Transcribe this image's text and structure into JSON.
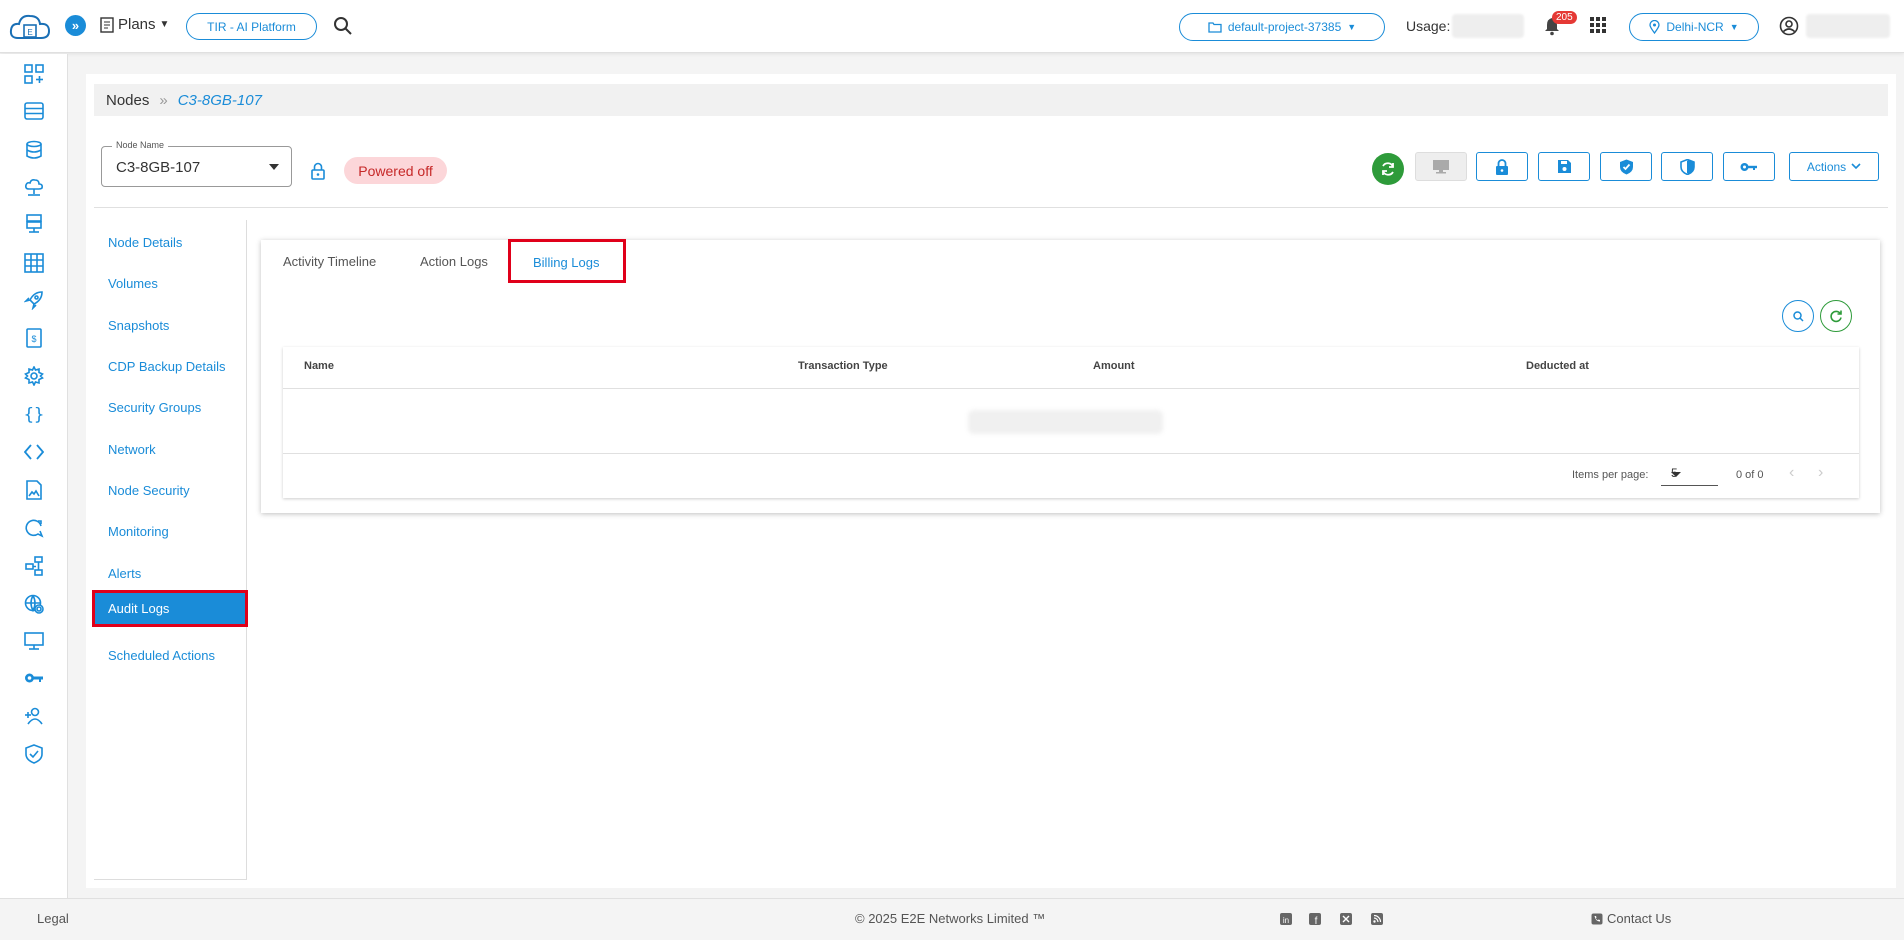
{
  "topbar": {
    "plans_label": "Plans",
    "tir_label": "TIR - AI Platform",
    "project_label": "default-project-37385",
    "usage_label": "Usage:",
    "notification_count": "205",
    "region_label": "Delhi-NCR"
  },
  "breadcrumb": {
    "root": "Nodes",
    "separator": "»",
    "current": "C3-8GB-107"
  },
  "node": {
    "field_label": "Node Name",
    "value": "C3-8GB-107",
    "status": "Powered off"
  },
  "toolbar": {
    "actions_label": "Actions"
  },
  "sidemenu": {
    "items": [
      {
        "label": "Node Details"
      },
      {
        "label": "Volumes"
      },
      {
        "label": "Snapshots"
      },
      {
        "label": "CDP Backup Details"
      },
      {
        "label": "Security Groups"
      },
      {
        "label": "Network"
      },
      {
        "label": "Node Security"
      },
      {
        "label": "Monitoring"
      },
      {
        "label": "Alerts"
      },
      {
        "label": "Audit Logs"
      },
      {
        "label": "Scheduled Actions"
      }
    ],
    "active_index": 9
  },
  "tabs": [
    {
      "label": "Activity Timeline"
    },
    {
      "label": "Action Logs"
    },
    {
      "label": "Billing Logs"
    }
  ],
  "table": {
    "columns": [
      "Name",
      "Transaction Type",
      "Amount",
      "Deducted at"
    ],
    "items_per_page_label": "Items per page:",
    "items_per_page": "5",
    "range_label": "0 of 0"
  },
  "footer": {
    "legal": "Legal",
    "copyright": "© 2025 E2E Networks Limited ™",
    "contact": "Contact Us"
  },
  "colors": {
    "accent": "#1a8cd8",
    "highlight": "#e0001a",
    "power_on": "#2e9b3a",
    "status_off_bg": "#fcd6d9"
  }
}
